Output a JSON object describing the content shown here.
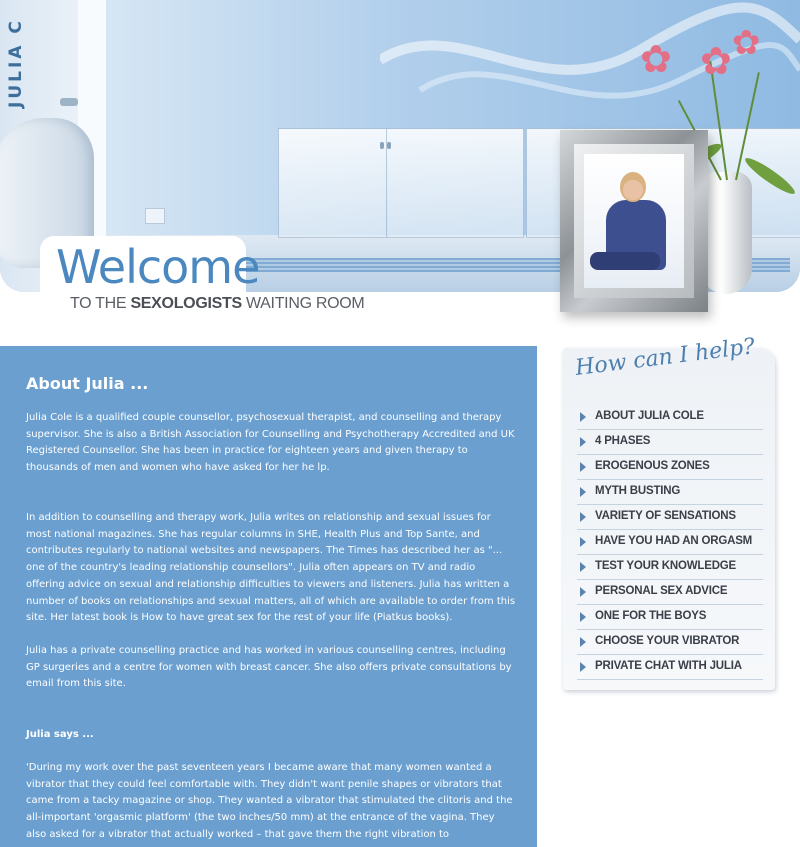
{
  "header": {
    "side_text": "JULIA C",
    "welcome": "Welcome",
    "subtitle_pre": "TO THE ",
    "subtitle_bold": "SEXOLOGISTS",
    "subtitle_post": " WAITING ROOM"
  },
  "main": {
    "title": "About Julia ...",
    "paragraphs": [
      "Julia Cole is a qualified couple counsellor, psychosexual therapist, and counselling and therapy supervisor. She is also a British Association for Counselling and Psychotherapy Accredited and UK Registered Counsellor. She has been in practice for eighteen years and given therapy to thousands of men and women who have asked for her he lp.",
      "In addition to counselling and therapy work, Julia writes on relationship and sexual issues for most national magazines. She has regular columns in SHE, Health Plus and Top Sante, and contributes regularly to national websites and newspapers. The Times has described her as \"... one of the country's leading relationship counsellors\". Julia often appears on TV and radio offering advice on sexual and relationship difficulties to viewers and listeners. Julia has written a number of books on relationships and sexual matters, all of which are available to order from this site. Her latest book is How to have great sex for the rest of your life (Piatkus books).",
      "Julia has a private counselling practice and has worked in various counselling centres, including GP surgeries and a centre for women with breast cancer. She also offers private consultations by email from this site."
    ],
    "says_title": "Julia says ...",
    "quote": "'During my work over the past seventeen years I became aware that many women wanted a vibrator that they could feel comfortable with. They didn't want penile shapes or vibrators that came from a tacky magazine or shop. They wanted a vibrator that stimulated the clitoris and the all-important 'orgasmic platform' (the two inches/50 mm) at the entrance of the vagina. They also asked for a vibrator that actually worked – that gave them the right vibration to"
  },
  "sidebar": {
    "title": "How can I help?",
    "items": [
      "ABOUT JULIA COLE",
      "4 PHASES",
      "EROGENOUS ZONES",
      "MYTH BUSTING",
      "VARIETY OF SENSATIONS",
      "HAVE YOU HAD AN ORGASM",
      "TEST YOUR KNOWLEDGE",
      "PERSONAL SEX ADVICE",
      "ONE FOR THE BOYS",
      "CHOOSE YOUR VIBRATOR",
      "PRIVATE CHAT WITH JULIA"
    ]
  },
  "colors": {
    "main_bg": "#6a9fd0",
    "welcome": "#4b88bf",
    "nav_text": "#3a3f48",
    "nav_arrow": "#5a84ad"
  }
}
